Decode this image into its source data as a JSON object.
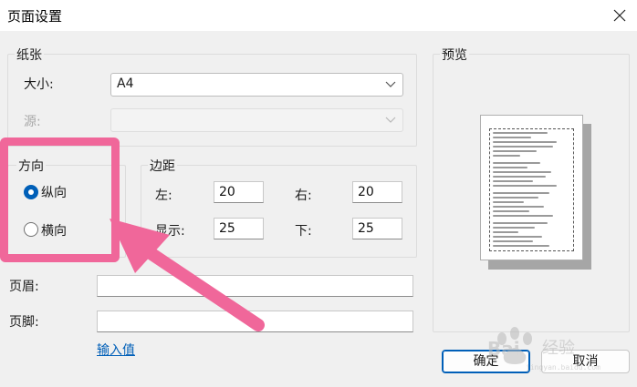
{
  "window": {
    "title": "页面设置"
  },
  "paper": {
    "group_label": "纸张",
    "size_label": "大小:",
    "size_value": "A4",
    "source_label": "源:",
    "source_value": ""
  },
  "orientation": {
    "group_label": "方向",
    "portrait_label": "纵向",
    "landscape_label": "横向",
    "selected": "portrait"
  },
  "margins": {
    "group_label": "边距",
    "left_label": "左:",
    "left_value": "20",
    "right_label": "右:",
    "right_value": "20",
    "top_label": "显示:",
    "top_value": "25",
    "bottom_label": "下:",
    "bottom_value": "25"
  },
  "header_footer": {
    "header_label": "页眉:",
    "header_value": "",
    "footer_label": "页脚:",
    "footer_value": "",
    "input_values_link": "输入值"
  },
  "preview": {
    "group_label": "预览"
  },
  "buttons": {
    "ok": "确定",
    "cancel": "取消"
  },
  "colors": {
    "accent": "#005fb8",
    "annotation": "#f0679a"
  }
}
